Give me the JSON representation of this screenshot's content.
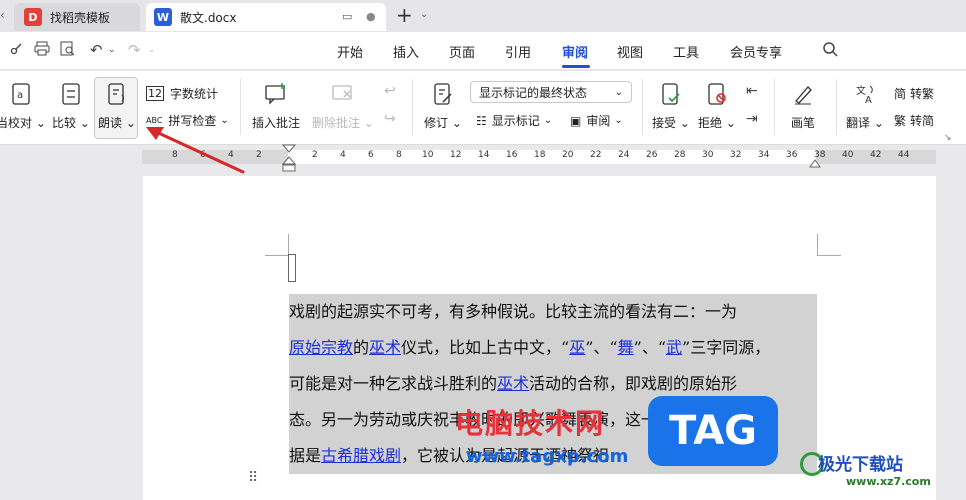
{
  "tabs": {
    "template": "找稻壳模板",
    "document": "散文.docx",
    "new_tab": "+"
  },
  "menu": {
    "items": [
      "开始",
      "插入",
      "页面",
      "引用",
      "审阅",
      "视图",
      "工具",
      "会员专享"
    ],
    "active": "审阅"
  },
  "ribbon": {
    "proofread": "当校对",
    "compare": "比较",
    "read_aloud": "朗读",
    "word_count": "字数统计",
    "spell_check": "拼写检查",
    "insert_comment": "插入批注",
    "delete_comment": "删除批注",
    "revise": "修订",
    "markup_select": "显示标记的最终状态",
    "show_markup": "显示标记",
    "review": "审阅",
    "accept": "接受",
    "reject": "拒绝",
    "pen": "画笔",
    "translate": "翻译",
    "to_traditional": "转繁",
    "to_simplified": "转简"
  },
  "ruler": {
    "left_ticks": [
      "8",
      "6",
      "4",
      "2"
    ],
    "right_ticks": [
      "2",
      "4",
      "6",
      "8",
      "10",
      "12",
      "14",
      "16",
      "18",
      "20",
      "22",
      "24",
      "26",
      "28",
      "30",
      "32",
      "34",
      "36",
      "38",
      "40",
      "42",
      "44"
    ]
  },
  "document": {
    "line1": "戏剧的起源实不可考，有多种假说。比较主流的看法有二：一为",
    "line2": {
      "link1": "原始宗教",
      "t1": "的",
      "link2": "巫术",
      "t2": "仪式，比如上古中文，“",
      "link3": "巫",
      "t3": "”、“",
      "link4": "舞",
      "t4": "”、“",
      "link5": "武",
      "t5": "”三字同源，"
    },
    "line3": {
      "t1": "可能是对一种乞求战斗胜利的",
      "link1": "巫术",
      "t2": "活动的合称，即戏剧的原始形"
    },
    "line4": "态。另一为劳动或庆祝丰收时的即兴歌舞表演，这一说法主要依",
    "line5": {
      "t1": "据是",
      "link1": "古希腊戏剧",
      "t2": "，它被认为是起源于酒神祭祀"
    }
  },
  "watermark": {
    "site_name": "电脑技术网",
    "site_url": "www.tagxp.com",
    "tag": "TAG",
    "brand": "极光下载站",
    "brand_url": "www.xz7.com"
  },
  "colors": {
    "accent": "#1f4fd6",
    "link": "#1b2fd6",
    "highlight": "#d2d2d2",
    "arrow": "#d62828"
  }
}
